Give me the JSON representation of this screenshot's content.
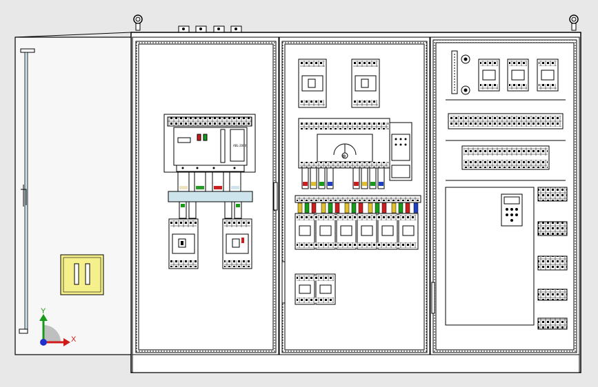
{
  "viewport": {
    "background": "#e8e8e8"
  },
  "colors": {
    "outline": "#000000",
    "panel_fill": "#ffffff",
    "door_fill": "#f7f7f7",
    "handle_plate": "#f5ef8c",
    "rail": "#cde4ec",
    "axis_y": "#1a9a1a",
    "axis_x": "#d01a1a",
    "axis_origin": "#2030d0",
    "triad_quadrant": "#b0b0b0"
  },
  "triad": {
    "x_label": "X",
    "y_label": "Y"
  },
  "device_labels": {
    "main_breaker_model": "ABL-2000",
    "controller_logo": "⊕"
  }
}
